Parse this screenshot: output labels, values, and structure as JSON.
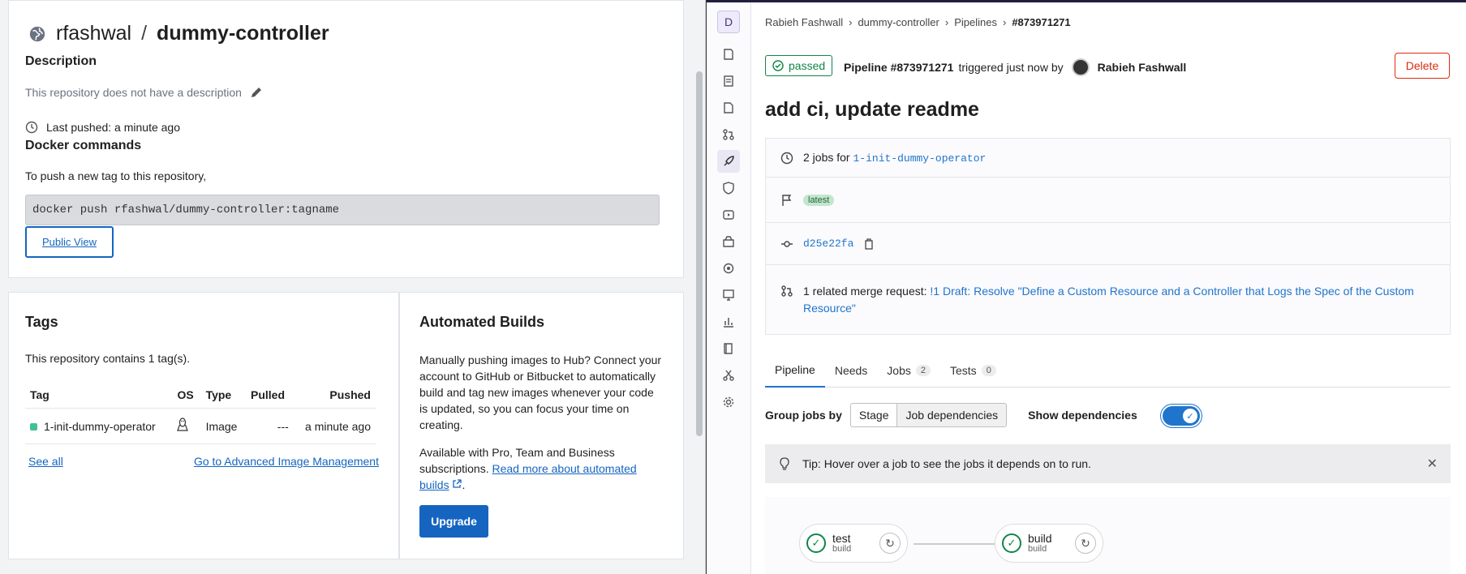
{
  "dockerhub": {
    "owner": "rfashwal",
    "slash": "/",
    "repo": "dummy-controller",
    "description_heading": "Description",
    "description_text": "This repository does not have a description",
    "last_pushed": "Last pushed: a minute ago",
    "docker_commands_heading": "Docker commands",
    "push_text": "To push a new tag to this repository,",
    "push_command": "docker push rfashwal/dummy-controller:tagname",
    "public_view_label": "Public View",
    "tags": {
      "heading": "Tags",
      "summary": "This repository contains 1 tag(s).",
      "columns": [
        "Tag",
        "OS",
        "Type",
        "Pulled",
        "Pushed"
      ],
      "rows": [
        {
          "tag": "1-init-dummy-operator",
          "os": "linux-icon",
          "type": "Image",
          "pulled": "---",
          "pushed": "a minute ago"
        }
      ],
      "see_all": "See all",
      "advanced": "Go to Advanced Image Management"
    },
    "builds": {
      "heading": "Automated Builds",
      "para1": "Manually pushing images to Hub? Connect your account to GitHub or Bitbucket to automatically build and tag new images whenever your code is updated, so you can focus your time on creating.",
      "para2_prefix": "Available with Pro, Team and Business subscriptions.",
      "para2_link": "Read more about automated builds",
      "para2_suffix": ".",
      "upgrade_label": "Upgrade"
    }
  },
  "gitlab": {
    "project_avatar": "D",
    "breadcrumbs": [
      "Rabieh Fashwall",
      "dummy-controller",
      "Pipelines",
      "#873971271"
    ],
    "status": "passed",
    "pipeline_id": "Pipeline #873971271",
    "triggered_text": "triggered just now by",
    "user": "Rabieh Fashwall",
    "delete_label": "Delete",
    "commit_title": "add ci, update readme",
    "jobs_for_prefix": "2 jobs for",
    "branch": "1-init-dummy-operator",
    "latest_badge": "latest",
    "commit_sha": "d25e22fa",
    "mr_prefix": "1 related merge request:",
    "mr_link": "!1 Draft: Resolve \"Define a Custom Resource and a Controller that Logs the Spec of the Custom Resource\"",
    "tabs": [
      {
        "label": "Pipeline",
        "count": ""
      },
      {
        "label": "Needs",
        "count": ""
      },
      {
        "label": "Jobs",
        "count": "2"
      },
      {
        "label": "Tests",
        "count": "0"
      }
    ],
    "group_jobs_by": "Group jobs by",
    "group_stage": "Stage",
    "group_deps": "Job dependencies",
    "show_deps": "Show dependencies",
    "show_deps_on": true,
    "tip": "Tip: Hover over a job to see the jobs it depends on to run.",
    "jobs": [
      {
        "name": "test",
        "stage": "build"
      },
      {
        "name": "build",
        "stage": "build"
      }
    ]
  },
  "colors": {
    "docker_blue": "#1565c0",
    "gitlab_blue": "#1f75cb",
    "success_green": "#108548",
    "danger_red": "#dd2b0e"
  }
}
